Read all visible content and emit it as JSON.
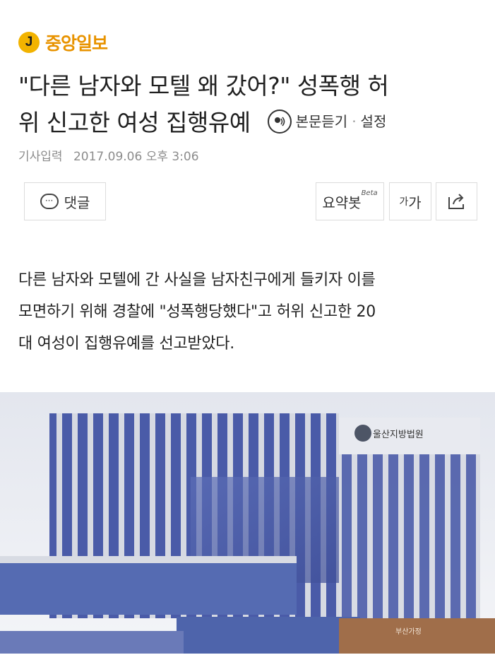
{
  "brand": {
    "logo_letter": "J",
    "name": "중앙일보",
    "color": "#e89300",
    "logo_bg": "#f2b300"
  },
  "article": {
    "title_line1": "\"다른 남자와 모텔 왜 갔어?\" 성폭행 허",
    "title_line2": "위 신고한 여성 집행유예",
    "tts_label": "본문듣기",
    "tts_separator": "·",
    "settings_label": "설정",
    "meta_label": "기사입력",
    "meta_date": "2017.09.06 오후 3:06",
    "body_line1": "다른 남자와 모텔에 간 사실을 남자친구에게 들키자 이를",
    "body_line2": "모면하기 위해 경찰에 \"성폭행당했다\"고 허위 신고한 20",
    "body_line3": "대 여성이 집행유예를 선고받았다."
  },
  "toolbar": {
    "comment_label": "댓글",
    "summary_label": "요약봇",
    "summary_badge": "Beta",
    "font_small": "가",
    "font_large": "가",
    "share_icon": "share-icon"
  },
  "photo": {
    "sign_text": "울산지방법원",
    "lower_sign": "부산가정"
  }
}
